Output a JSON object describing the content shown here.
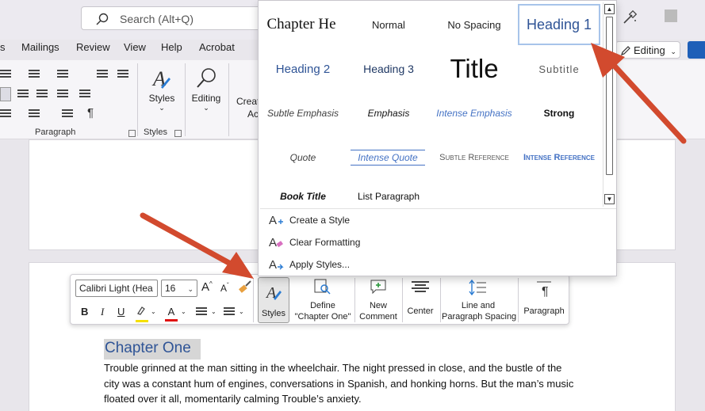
{
  "search": {
    "placeholder": "Search (Alt+Q)"
  },
  "tabs": [
    {
      "label": "s"
    },
    {
      "label": "Mailings"
    },
    {
      "label": "Review"
    },
    {
      "label": "View"
    },
    {
      "label": "Help"
    },
    {
      "label": "Acrobat"
    }
  ],
  "editing_mode": {
    "label": "Editing"
  },
  "ribbon": {
    "paragraph_group": "Paragraph",
    "styles_group": "Styles",
    "styles_button": "Styles",
    "editing_button": "Editing",
    "create_partial": "Creat",
    "create_partial2": "Ac"
  },
  "style_gallery": {
    "styles": [
      {
        "label": "Chapter He"
      },
      {
        "label": "Normal"
      },
      {
        "label": "No Spacing"
      },
      {
        "label": "Heading 1"
      },
      {
        "label": "Heading 2"
      },
      {
        "label": "Heading 3"
      },
      {
        "label": "Title"
      },
      {
        "label": "Subtitle"
      },
      {
        "label": "Subtle Emphasis"
      },
      {
        "label": "Emphasis"
      },
      {
        "label": "Intense Emphasis"
      },
      {
        "label": "Strong"
      },
      {
        "label": "Quote"
      },
      {
        "label": "Intense Quote"
      },
      {
        "label": "Subtle Reference"
      },
      {
        "label": "Intense Reference"
      },
      {
        "label": "Book Title"
      },
      {
        "label": "List Paragraph"
      }
    ],
    "actions": [
      {
        "label": "Create a Style"
      },
      {
        "label": "Clear Formatting"
      },
      {
        "label": "Apply Styles..."
      }
    ]
  },
  "mini_toolbar": {
    "font": "Calibri Light (Hea",
    "size": "16",
    "bold": "B",
    "italic": "I",
    "underline": "U",
    "styles": "Styles",
    "define_line1": "Define",
    "define_line2": "\"Chapter One\"",
    "new_comment_line1": "New",
    "new_comment_line2": "Comment",
    "center": "Center",
    "spacing_line1": "Line and",
    "spacing_line2": "Paragraph Spacing",
    "paragraph": "Paragraph"
  },
  "document": {
    "heading": "Chapter One",
    "lines": [
      "Trouble grinned at the man sitting in the wheelchair. The night pressed in close, and the bustle of the",
      "city was a constant hum of engines, conversations in Spanish, and honking horns. But the man’s music",
      "floated over it all, momentarily calming Trouble’s anxiety."
    ]
  },
  "colors": {
    "heading_blue": "#2f5496",
    "arrow_red": "#d24a2e",
    "highlight_yellow": "#f5e000",
    "font_color_red": "#e01010"
  }
}
